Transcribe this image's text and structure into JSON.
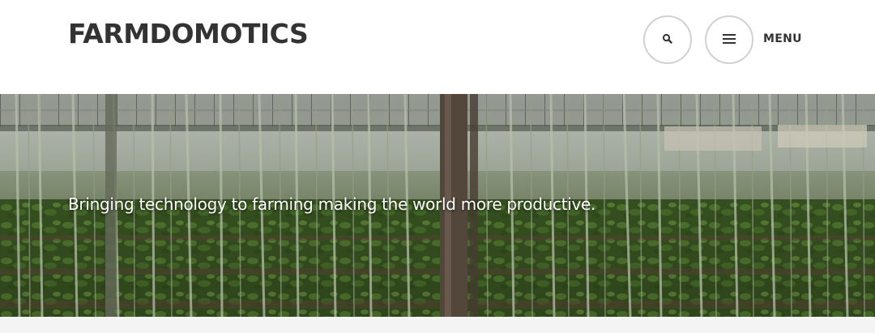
{
  "header": {
    "site_title": "FARMDOMOTICS",
    "search_icon": "search-icon",
    "menu_icon": "hamburger-icon",
    "menu_label": "MENU"
  },
  "hero": {
    "tagline": "Bringing technology to farming making the world more productive.",
    "image_subject": "greenhouse with pepper plants and hanging support strings"
  },
  "colors": {
    "title_text": "#333333",
    "button_border": "#d1d1d1",
    "tagline_text": "#ffffff",
    "footer_band": "#f4f4f4"
  }
}
